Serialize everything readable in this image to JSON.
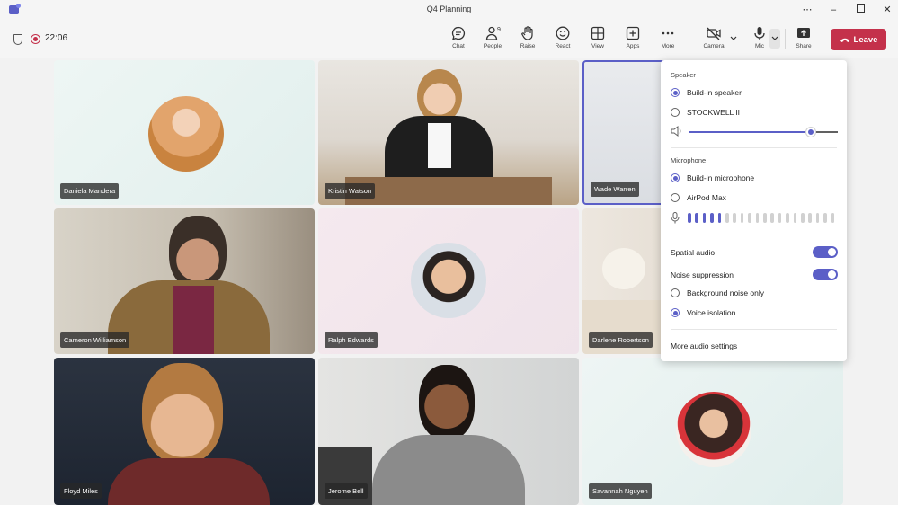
{
  "window": {
    "title": "Q4 Planning"
  },
  "meeting": {
    "timer": "22:06"
  },
  "toolbar": {
    "chat": "Chat",
    "people": "People",
    "people_count": "9",
    "raise": "Raise",
    "react": "React",
    "view": "View",
    "apps": "Apps",
    "more": "More",
    "camera": "Camera",
    "mic": "Mic",
    "share": "Share",
    "leave": "Leave"
  },
  "participants": [
    {
      "name": "Daniela Mandera",
      "display": "avatar"
    },
    {
      "name": "Kristin Watson",
      "display": "video"
    },
    {
      "name": "Wade Warren",
      "display": "video",
      "active_speaker": true
    },
    {
      "name": "Cameron Williamson",
      "display": "video"
    },
    {
      "name": "Ralph Edwards",
      "display": "avatar"
    },
    {
      "name": "Darlene Robertson",
      "display": "video"
    },
    {
      "name": "Floyd Miles",
      "display": "video"
    },
    {
      "name": "Jerome Bell",
      "display": "video"
    },
    {
      "name": "Savannah Nguyen",
      "display": "avatar"
    }
  ],
  "audio_panel": {
    "speaker_heading": "Speaker",
    "speakers": [
      {
        "label": "Build-in speaker",
        "selected": true
      },
      {
        "label": "STOCKWELL II",
        "selected": false
      }
    ],
    "speaker_volume": 0.82,
    "microphone_heading": "Microphone",
    "microphones": [
      {
        "label": "Build-in microphone",
        "selected": true
      },
      {
        "label": "AirPod Max",
        "selected": false
      }
    ],
    "mic_level_active_bars": 5,
    "mic_level_total_bars": 20,
    "spatial_audio": {
      "label": "Spatial audio",
      "on": true
    },
    "noise_suppression": {
      "label": "Noise suppression",
      "on": true
    },
    "noise_modes": [
      {
        "label": "Background noise only",
        "selected": false
      },
      {
        "label": "Voice isolation",
        "selected": true
      }
    ],
    "more_settings": "More audio settings"
  },
  "colors": {
    "accent": "#5b5fc7",
    "leave": "#c4314b"
  }
}
